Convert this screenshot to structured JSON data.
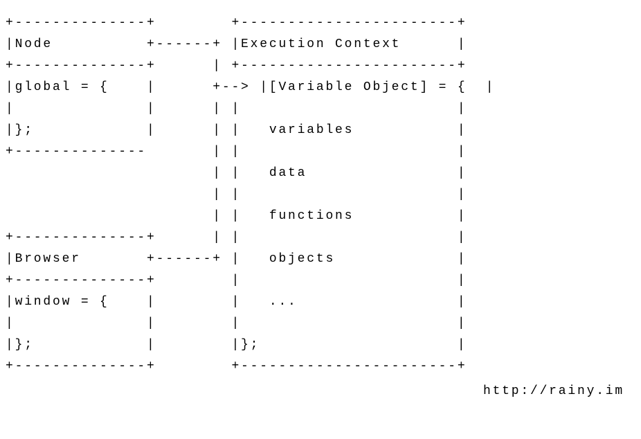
{
  "diagram": {
    "left_boxes": {
      "node": {
        "title": "Node",
        "body_open": "global = {",
        "body_close": "};"
      },
      "browser": {
        "title": "Browser",
        "body_open": "window = {",
        "body_close": "};"
      }
    },
    "right_box": {
      "title": "Execution Context",
      "body_open": "[Variable Object] = {",
      "items": [
        "variables",
        "data",
        "functions",
        "objects",
        "..."
      ],
      "body_close": "};"
    },
    "arrow": "+-->"
  },
  "attribution": "http://rainy.im",
  "ascii_lines": [
    "+--------------+        +-----------------------+",
    "|Node          +------+ |Execution Context      |",
    "+--------------+      | +-----------------------+",
    "|global = {    |      +--> |[Variable Object] = {  |",
    "|              |      | |                       |",
    "|};            |      | |   variables           |",
    "+--------------       | |                       |",
    "                      | |   data                |",
    "                      | |                       |",
    "                      | |   functions           |",
    "+--------------+      | |                       |",
    "|Browser       +------+ |   objects             |",
    "+--------------+        |                       |",
    "|window = {    |        |   ...                 |",
    "|              |        |                       |",
    "|};            |        |};                     |",
    "+--------------+        +-----------------------+"
  ]
}
